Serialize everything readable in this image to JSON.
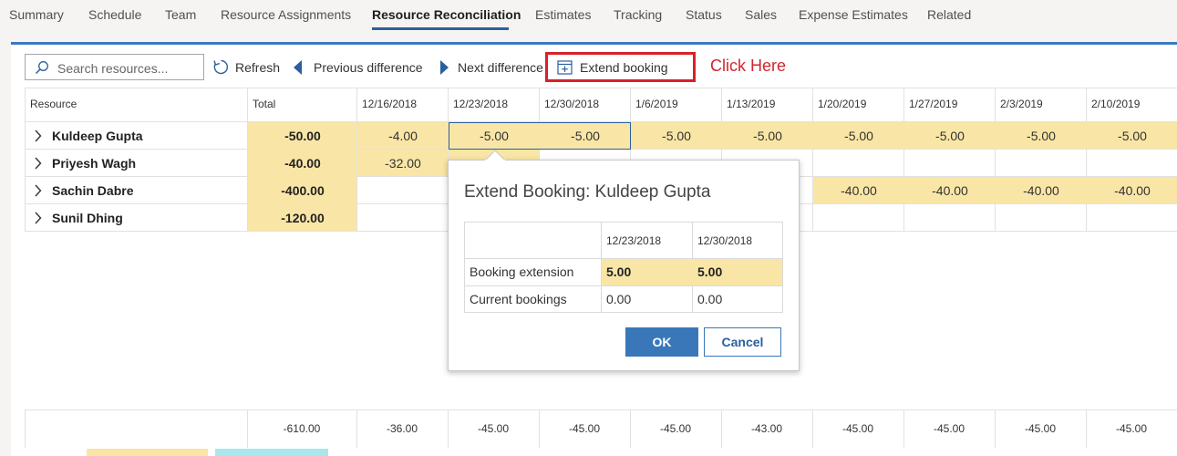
{
  "nav": {
    "tabs": [
      {
        "label": "Summary"
      },
      {
        "label": "Schedule"
      },
      {
        "label": "Team"
      },
      {
        "label": "Resource Assignments"
      },
      {
        "label": "Resource Reconciliation",
        "active": true
      },
      {
        "label": "Estimates"
      },
      {
        "label": "Tracking"
      },
      {
        "label": "Status"
      },
      {
        "label": "Sales"
      },
      {
        "label": "Expense Estimates"
      },
      {
        "label": "Related"
      }
    ]
  },
  "toolbar": {
    "search_placeholder": "Search resources...",
    "refresh_label": "Refresh",
    "prev_label": "Previous difference",
    "next_label": "Next difference",
    "extend_label": "Extend booking",
    "annotation": "Click Here"
  },
  "grid": {
    "resource_header": "Resource",
    "total_header": "Total",
    "dates": [
      "12/16/2018",
      "12/23/2018",
      "12/30/2018",
      "1/6/2019",
      "1/13/2019",
      "1/20/2019",
      "1/27/2019",
      "2/3/2019",
      "2/10/2019"
    ],
    "rows": [
      {
        "name": "Kuldeep Gupta",
        "total": "-50.00",
        "values": [
          "-4.00",
          "-5.00",
          "-5.00",
          "-5.00",
          "-5.00",
          "-5.00",
          "-5.00",
          "-5.00",
          "-5.00"
        ]
      },
      {
        "name": "Priyesh Wagh",
        "total": "-40.00",
        "values": [
          "-32.00",
          "",
          "",
          "",
          "",
          "",
          "",
          "",
          ""
        ]
      },
      {
        "name": "Sachin Dabre",
        "total": "-400.00",
        "values": [
          "",
          "",
          "",
          "",
          "",
          "-40.00",
          "-40.00",
          "-40.00",
          "-40.00"
        ]
      },
      {
        "name": "Sunil Dhing",
        "total": "-120.00",
        "values": [
          "",
          "",
          "",
          "",
          "",
          "",
          "",
          "",
          ""
        ]
      }
    ],
    "footer": [
      "-610.00",
      "-36.00",
      "-45.00",
      "-45.00",
      "-45.00",
      "-43.00",
      "-45.00",
      "-45.00",
      "-45.00",
      "-45.00"
    ]
  },
  "popup": {
    "title": "Extend Booking: Kuldeep Gupta",
    "dates": [
      "12/23/2018",
      "12/30/2018"
    ],
    "rows": [
      {
        "label": "Booking extension",
        "values": [
          "5.00",
          "5.00"
        ]
      },
      {
        "label": "Current bookings",
        "values": [
          "0.00",
          "0.00"
        ]
      }
    ],
    "ok_label": "OK",
    "cancel_label": "Cancel"
  },
  "colors": {
    "accent": "#3b78c2",
    "highlight": "#f9e6a6",
    "annotation_red": "#d9202a",
    "legend_teal": "#a8e8ec"
  }
}
